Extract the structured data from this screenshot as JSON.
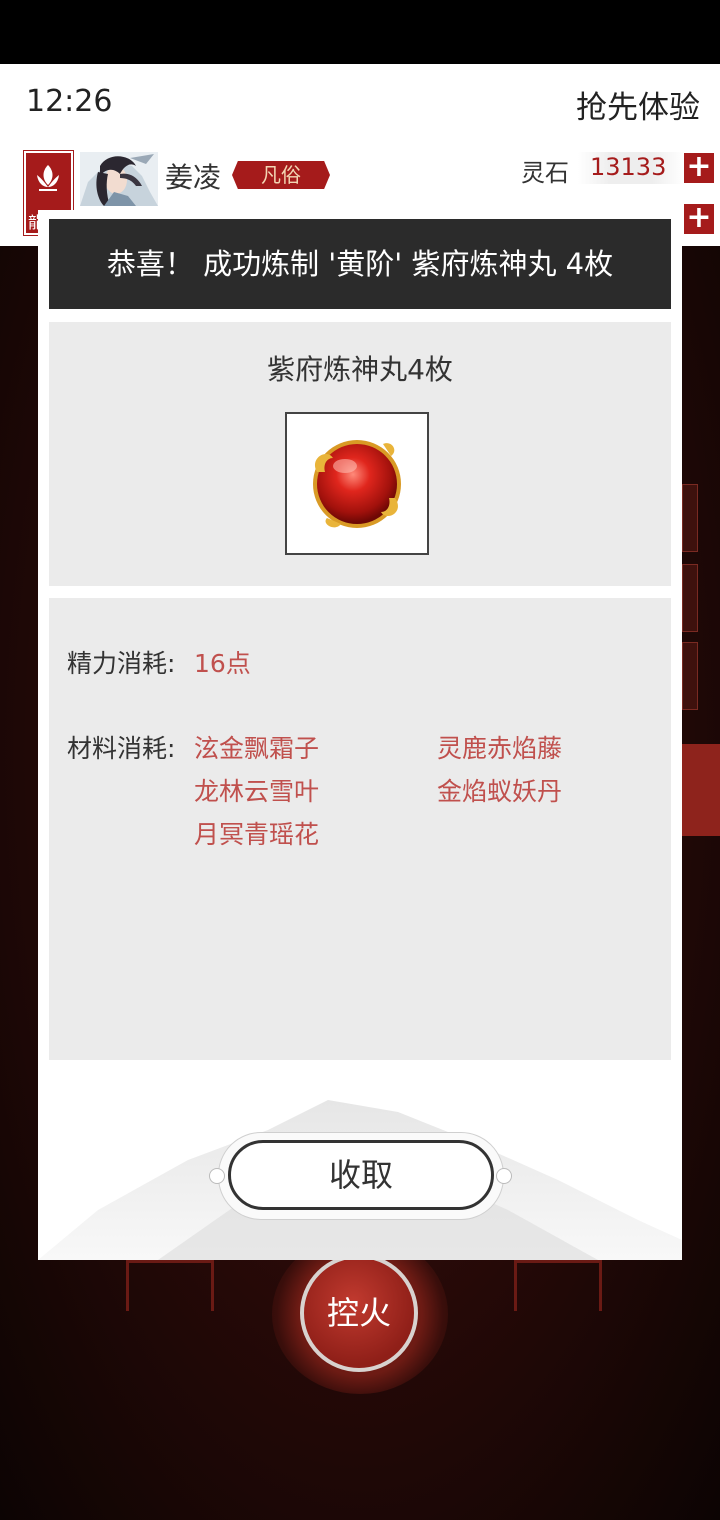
{
  "status": {
    "time": "12:26",
    "early_access": "抢先体验"
  },
  "player": {
    "name": "姜凌",
    "rank": "凡俗",
    "banner_char": "龍"
  },
  "currency": {
    "label": "灵石",
    "value": "13133"
  },
  "background": {
    "fire_button": "控火"
  },
  "modal": {
    "title": "恭喜！ 成功炼制 '黄阶' 紫府炼神丸 4枚",
    "item_name": "紫府炼神丸4枚",
    "energy_label": "精力消耗:",
    "energy_value": "16点",
    "materials_label": "材料消耗:",
    "materials": [
      "泫金飘霜子",
      "灵鹿赤焰藤",
      "龙林云雪叶",
      "金焰蚁妖丹",
      "月冥青瑶花"
    ],
    "collect_button": "收取"
  },
  "colors": {
    "accent": "#a51b1b",
    "cost_text": "#c0504d",
    "title_bar": "#2b2b2b",
    "panel": "#ebebeb"
  }
}
